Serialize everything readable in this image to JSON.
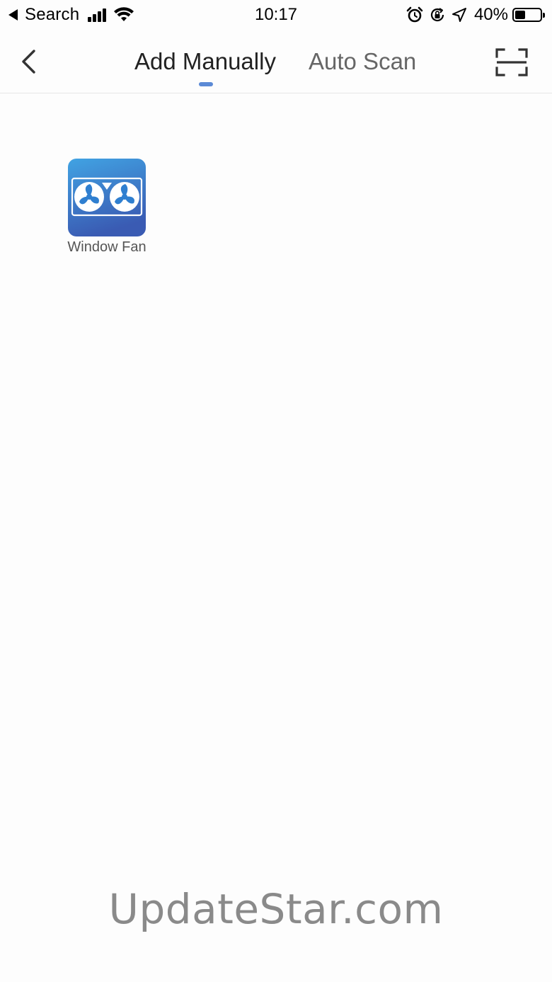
{
  "status_bar": {
    "back_label": "Search",
    "time": "10:17",
    "battery_percent_text": "40%",
    "battery_level": 0.4,
    "icons": [
      "back-triangle-icon",
      "cellular-signal-icon",
      "wifi-icon",
      "alarm-icon",
      "orientation-lock-icon",
      "location-arrow-icon",
      "battery-icon"
    ]
  },
  "nav": {
    "back_icon": "chevron-left-icon",
    "tabs": [
      {
        "label": "Add Manually",
        "active": true
      },
      {
        "label": "Auto Scan",
        "active": false
      }
    ],
    "scan_icon": "qr-scan-icon",
    "indicator_color": "#5b8ad6"
  },
  "devices": [
    {
      "label": "Window Fan",
      "icon": "window-fan-icon"
    }
  ],
  "watermark": "UpdateStar.com",
  "colors": {
    "icon_gradient_top": "#3f9fe0",
    "icon_gradient_bottom": "#3a5fb5",
    "accent": "#5b8ad6"
  }
}
